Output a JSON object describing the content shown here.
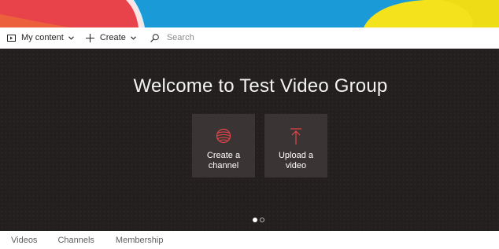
{
  "toolbar": {
    "my_content_label": "My content",
    "create_label": "Create",
    "search_placeholder": "Search"
  },
  "hero": {
    "title": "Welcome to Test Video Group",
    "tiles": [
      {
        "label_line1": "Create a",
        "label_line2": "channel",
        "icon": "globe-icon"
      },
      {
        "label_line1": "Upload a",
        "label_line2": "video",
        "icon": "upload-arrow-icon"
      }
    ],
    "carousel": {
      "total": 2,
      "active_index": 0
    }
  },
  "tabs": [
    "Videos",
    "Channels",
    "Membership"
  ],
  "colors": {
    "banner_blue": "#1a9ad6",
    "banner_red": "#e8424a",
    "banner_yellow": "#f3e21c",
    "hero_background": "#231f1e",
    "tile_background": "#3a3534",
    "icon_accent": "#e8464a"
  }
}
